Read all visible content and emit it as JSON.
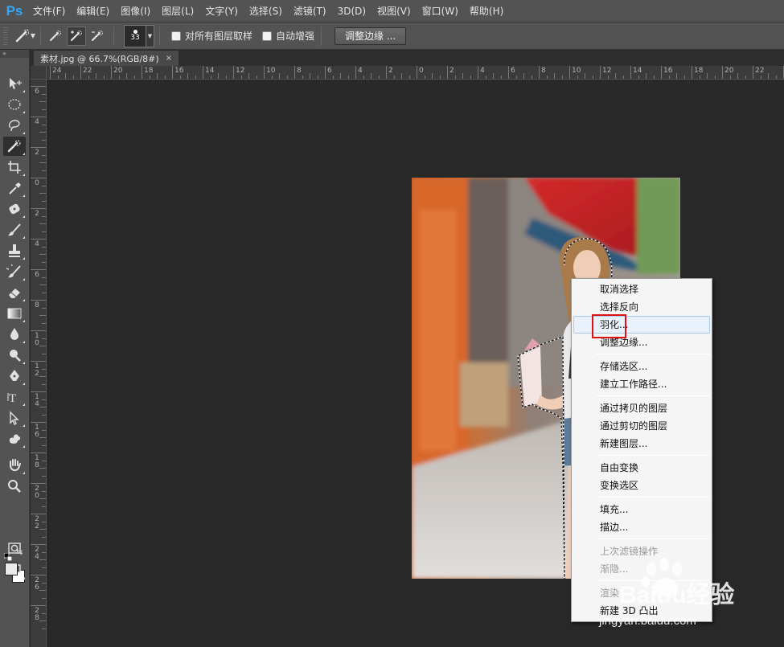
{
  "app": {
    "logo": "Ps"
  },
  "menubar": {
    "items": [
      "文件(F)",
      "编辑(E)",
      "图像(I)",
      "图层(L)",
      "文字(Y)",
      "选择(S)",
      "滤镜(T)",
      "3D(D)",
      "视图(V)",
      "窗口(W)",
      "帮助(H)"
    ]
  },
  "options": {
    "tool_icon": "quick-selection-icon",
    "brush_size": "33",
    "sample_all_layers_label": "对所有图层取样",
    "auto_enhance_label": "自动增强",
    "refine_edge_button": "调整边缘 ..."
  },
  "toolbar": {
    "header": "»",
    "tools": [
      "move-icon",
      "elliptical-marquee-icon",
      "lasso-icon",
      "quick-selection-icon",
      "crop-icon",
      "eyedropper-icon",
      "spot-healing-icon",
      "brush-icon",
      "clone-stamp-icon",
      "history-brush-icon",
      "eraser-icon",
      "gradient-icon",
      "blur-icon",
      "dodge-icon",
      "pen-icon",
      "type-icon",
      "path-selection-icon",
      "custom-shape-icon",
      "hand-icon",
      "zoom-icon"
    ],
    "active_tool": "quick-selection-icon",
    "foreground_color": "#eaeaea",
    "background_color": "#ffffff"
  },
  "document": {
    "tab_title": "素材.jpg @ 66.7%(RGB/8#)",
    "close_glyph": "×"
  },
  "rulers": {
    "top_labels": [
      "24",
      "22",
      "20",
      "18",
      "16",
      "14",
      "12",
      "10",
      "8",
      "6",
      "4",
      "2",
      "0",
      "2",
      "4",
      "6",
      "8",
      "10",
      "12",
      "14",
      "16",
      "18",
      "20",
      "22",
      "24"
    ],
    "left_labels": [
      "6",
      "4",
      "2",
      "0",
      "2",
      "4",
      "6",
      "8",
      "10",
      "12",
      "14",
      "16",
      "18",
      "20",
      "22",
      "24",
      "26",
      "28"
    ]
  },
  "context_menu": {
    "items": [
      {
        "label": "取消选择",
        "state": "normal"
      },
      {
        "label": "选择反向",
        "state": "normal"
      },
      {
        "label": "羽化...",
        "state": "hover"
      },
      {
        "label": "调整边缘...",
        "state": "normal"
      },
      {
        "label": "存储选区...",
        "state": "normal"
      },
      {
        "label": "建立工作路径...",
        "state": "normal"
      },
      {
        "label": "通过拷贝的图层",
        "state": "normal"
      },
      {
        "label": "通过剪切的图层",
        "state": "normal"
      },
      {
        "label": "新建图层...",
        "state": "normal"
      },
      {
        "label": "自由变换",
        "state": "normal"
      },
      {
        "label": "变换选区",
        "state": "normal"
      },
      {
        "label": "填充...",
        "state": "normal"
      },
      {
        "label": "描边...",
        "state": "normal"
      },
      {
        "label": "上次滤镜操作",
        "state": "disabled"
      },
      {
        "label": "渐隐...",
        "state": "disabled"
      },
      {
        "label": "渲染",
        "state": "disabled"
      },
      {
        "label": "新建 3D 凸出",
        "state": "normal"
      }
    ]
  },
  "watermark": {
    "brand": "Baidu经验",
    "url": "jingyan.baidu.com"
  }
}
